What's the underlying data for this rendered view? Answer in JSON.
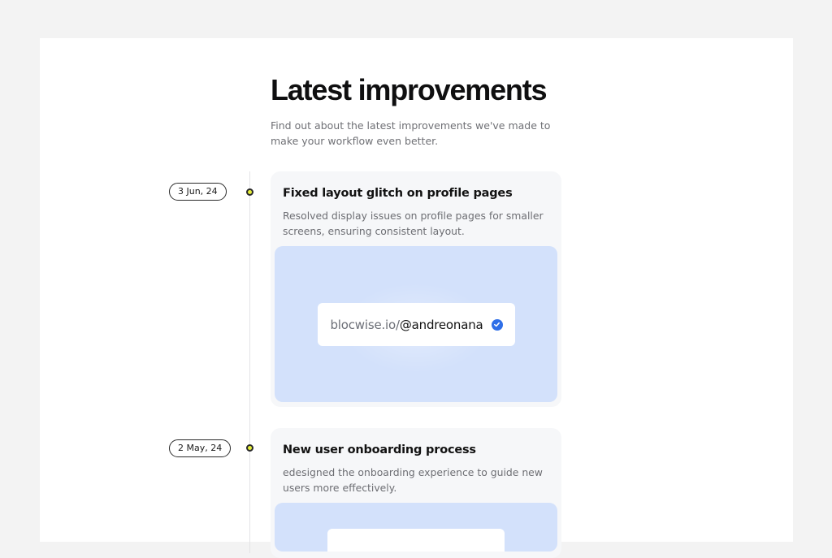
{
  "header": {
    "title": "Latest improvements",
    "subtitle": "Find out about the latest improvements we've made to make your workflow even better."
  },
  "entries": [
    {
      "date": "3 Jun, 24",
      "title": "Fixed layout glitch on profile pages",
      "description": "Resolved display issues on profile pages for smaller screens, ensuring consistent layout.",
      "preview": {
        "domain": "blocwise.io/",
        "handle": "@andreonana",
        "icon": "verified-check-icon"
      }
    },
    {
      "date": "2 May, 24",
      "title": "New user onboarding process",
      "description": "edesigned the onboarding experience to guide new users more effectively."
    }
  ],
  "colors": {
    "background": "#f3f3f3",
    "card": "#f6f7f9",
    "preview": "#d3e1fb",
    "dot": "#e6ef3a",
    "verified": "#2f6fe8"
  }
}
